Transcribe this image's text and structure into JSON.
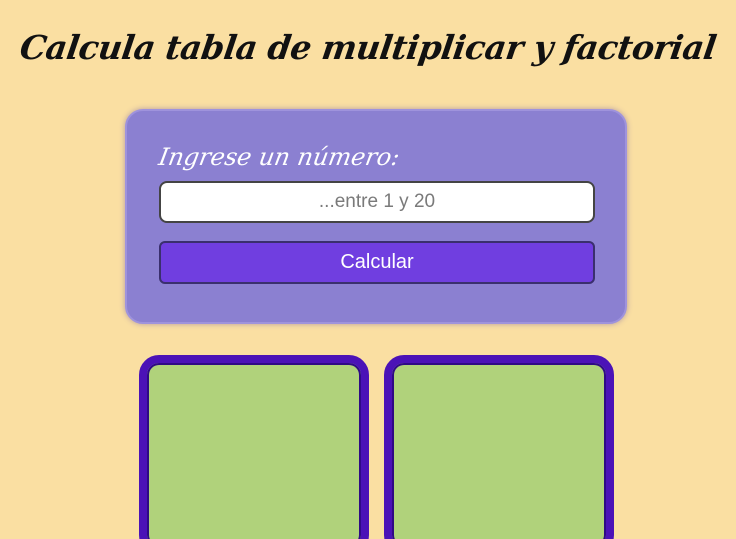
{
  "header": {
    "title": "Calcula tabla de multiplicar y factorial"
  },
  "form": {
    "label": "Ingrese un número:",
    "input_placeholder": "...entre 1 y 20",
    "input_value": "",
    "button_label": "Calcular"
  },
  "colors": {
    "background": "#fadfa2",
    "form_card": "#8b80d1",
    "button": "#703ee0",
    "result_panel_fill": "#b0d27b",
    "result_panel_border": "#4b12b7"
  }
}
